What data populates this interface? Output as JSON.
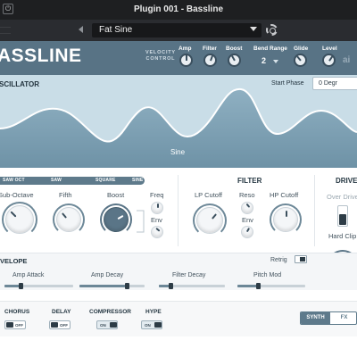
{
  "window": {
    "title": "Plugin 001 - Bassline"
  },
  "preset": {
    "name": "Fat Sine"
  },
  "header": {
    "logo": "ASSLINE",
    "velocity_control": "VELOCITY\nCONTROL",
    "controls": [
      {
        "label": "Amp"
      },
      {
        "label": "Filter"
      },
      {
        "label": "Boost"
      },
      {
        "label": "Bend Range"
      },
      {
        "label": "Glide"
      },
      {
        "label": "Level"
      }
    ],
    "bend_range_value": "2",
    "brand_mark": "ai"
  },
  "oscillator": {
    "title": "SCILLATOR",
    "start_phase_label": "Start Phase",
    "start_phase_value": "0 Degr",
    "waveform_label": "Sine"
  },
  "wave_tabs": [
    "SAW OCT",
    "SAW",
    "SQUARE",
    "SINE"
  ],
  "osc_knobs": {
    "sub_octave": "Sub-Octave",
    "fifth": "Fifth",
    "boost": "Boost",
    "freq": "Freq",
    "env": "Env"
  },
  "filter": {
    "title": "FILTER",
    "lp_cutoff": "LP Cutoff",
    "reso": "Reso",
    "hp_cutoff": "HP Cutoff",
    "env": "Env"
  },
  "drive": {
    "title": "DRIVE",
    "over_drive": "Over Drive",
    "hard_clip": "Hard Clip"
  },
  "envelope": {
    "title": "VELOPE",
    "retrig_label": "Retrig",
    "sliders": [
      {
        "label": "Amp Attack",
        "value": 0.24
      },
      {
        "label": "Amp Decay",
        "value": 0.72
      },
      {
        "label": "Filter Decay",
        "value": 0.17
      },
      {
        "label": "Pitch Mod",
        "value": 0.3
      }
    ]
  },
  "effects": [
    {
      "label": "CHORUS",
      "state": "OFF"
    },
    {
      "label": "DELAY",
      "state": "OFF"
    },
    {
      "label": "COMPRESSOR",
      "state": "ON"
    },
    {
      "label": "HYPE",
      "state": "ON"
    }
  ],
  "mode_switch": {
    "synth": "SYNTH",
    "fx": "FX"
  },
  "colors": {
    "accent": "#587385",
    "display_bg": "#c9dde7",
    "titlebar": "#1e1f21"
  }
}
